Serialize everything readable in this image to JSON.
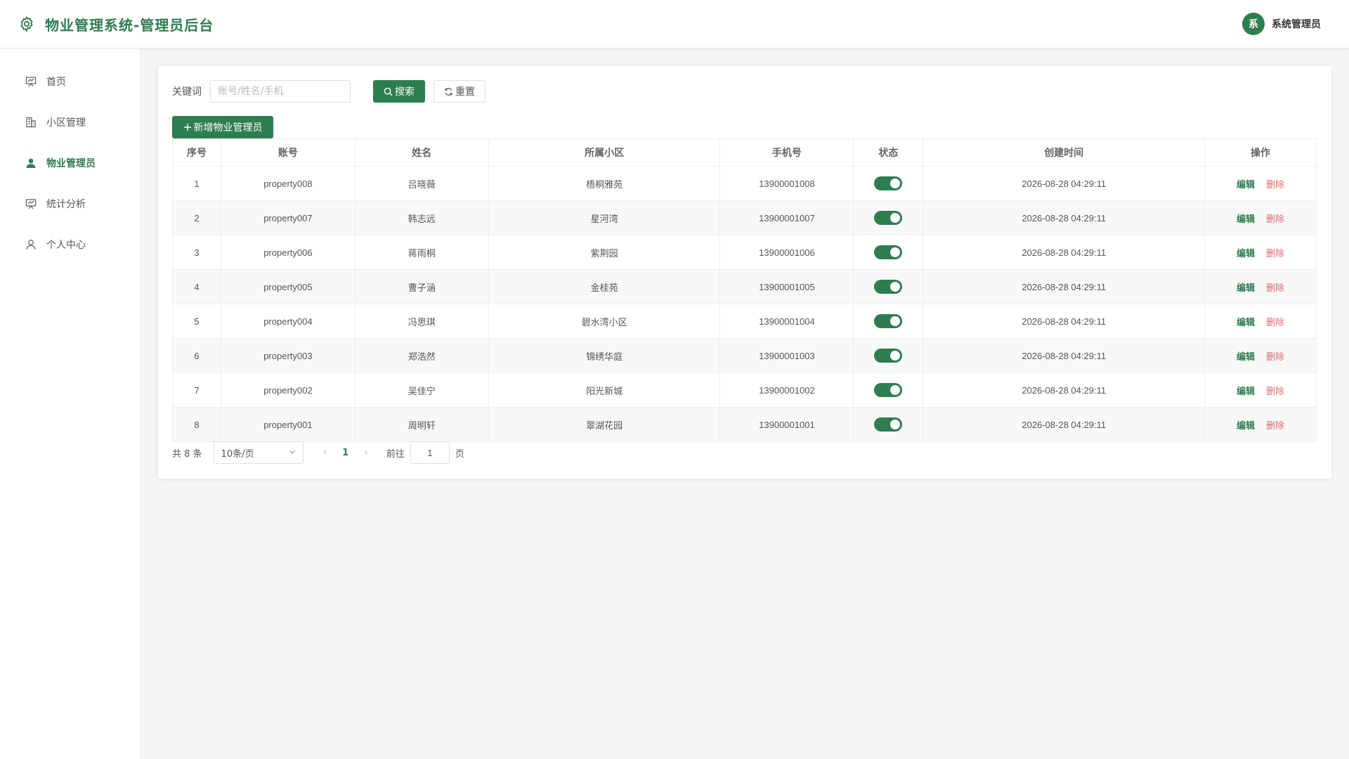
{
  "header": {
    "title": "物业管理系统-管理员后台",
    "user_avatar_text": "系",
    "user_name": "系统管理员",
    "accent_color": "#2e7d4f"
  },
  "sidebar": {
    "items": [
      {
        "label": "首页",
        "icon": "presentation-board-icon",
        "active": false
      },
      {
        "label": "小区管理",
        "icon": "building-icon",
        "active": false
      },
      {
        "label": "物业管理员",
        "icon": "user-filled-icon",
        "active": true
      },
      {
        "label": "统计分析",
        "icon": "chart-board-icon",
        "active": false
      },
      {
        "label": "个人中心",
        "icon": "user-outline-icon",
        "active": false
      }
    ]
  },
  "search": {
    "label": "关键词",
    "placeholder": "账号/姓名/手机",
    "value": "",
    "search_label": "搜索",
    "reset_label": "重置"
  },
  "toolbar": {
    "add_label": "新增物业管理员"
  },
  "table": {
    "columns": [
      "序号",
      "账号",
      "姓名",
      "所属小区",
      "手机号",
      "状态",
      "创建时间",
      "操作"
    ],
    "edit_label": "编辑",
    "delete_label": "删除",
    "rows": [
      {
        "no": "1",
        "account": "property008",
        "name": "吕晓薇",
        "community": "梧桐雅苑",
        "phone": "13900001008",
        "enabled": true,
        "created": "2026-08-28 04:29:11"
      },
      {
        "no": "2",
        "account": "property007",
        "name": "韩志远",
        "community": "星河湾",
        "phone": "13900001007",
        "enabled": true,
        "created": "2026-08-28 04:29:11"
      },
      {
        "no": "3",
        "account": "property006",
        "name": "蒋雨桐",
        "community": "紫荆园",
        "phone": "13900001006",
        "enabled": true,
        "created": "2026-08-28 04:29:11"
      },
      {
        "no": "4",
        "account": "property005",
        "name": "曹子涵",
        "community": "金桂苑",
        "phone": "13900001005",
        "enabled": true,
        "created": "2026-08-28 04:29:11"
      },
      {
        "no": "5",
        "account": "property004",
        "name": "冯思琪",
        "community": "碧水湾小区",
        "phone": "13900001004",
        "enabled": true,
        "created": "2026-08-28 04:29:11"
      },
      {
        "no": "6",
        "account": "property003",
        "name": "郑浩然",
        "community": "锦绣华庭",
        "phone": "13900001003",
        "enabled": true,
        "created": "2026-08-28 04:29:11"
      },
      {
        "no": "7",
        "account": "property002",
        "name": "吴佳宁",
        "community": "阳光新城",
        "phone": "13900001002",
        "enabled": true,
        "created": "2026-08-28 04:29:11"
      },
      {
        "no": "8",
        "account": "property001",
        "name": "周明轩",
        "community": "翠湖花园",
        "phone": "13900001001",
        "enabled": true,
        "created": "2026-08-28 04:29:11"
      }
    ]
  },
  "pagination": {
    "total_text": "共 8 条",
    "page_size": "10条/页",
    "current_page": "1",
    "goto_label": "前往",
    "goto_value": "1",
    "goto_suffix": "页"
  }
}
